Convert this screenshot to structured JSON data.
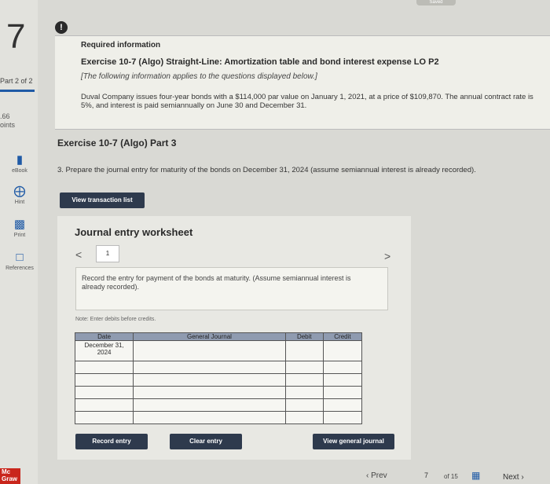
{
  "question_number": "7",
  "part_label": "Part 2 of 2",
  "points": [
    ".66",
    "oints"
  ],
  "tools": [
    {
      "label": "eBook",
      "icon": "book-icon"
    },
    {
      "label": "Hint",
      "icon": "hint-icon"
    },
    {
      "label": "Print",
      "icon": "print-icon"
    },
    {
      "label": "References",
      "icon": "references-icon"
    }
  ],
  "logo": [
    "Mc",
    "Graw"
  ],
  "saved": "Saved",
  "info": {
    "alert": "!",
    "required": "Required information",
    "exercise_title": "Exercise 10-7 (Algo) Straight-Line: Amortization table and bond interest expense LO P2",
    "note": "[The following information applies to the questions displayed below.]",
    "body": "Duval Company issues four-year bonds with a $114,000 par value on January 1, 2021, at a price of $109,870. The annual contract rate is 5%, and interest is paid semiannually on June 30 and December 31."
  },
  "part_title": "Exercise 10-7 (Algo) Part 3",
  "question": "3. Prepare the journal entry for maturity of the bonds on December 31, 2024 (assume semiannual interest is already recorded).",
  "view_transaction_list": "View transaction list",
  "worksheet": {
    "title": "Journal entry worksheet",
    "nav_prev": "<",
    "nav_next": ">",
    "tab": "1",
    "entry_text": "Record the entry for payment of the bonds at maturity. (Assume semiannual interest is already recorded).",
    "note": "Note: Enter debits before credits.",
    "headers": {
      "date": "Date",
      "journal": "General Journal",
      "debit": "Debit",
      "credit": "Credit"
    },
    "date_value": "December 31, 2024",
    "record_entry": "Record entry",
    "clear_entry": "Clear entry",
    "view_general_journal": "View general journal"
  },
  "footer": {
    "prev": "Prev",
    "page": "7",
    "of": "of 15",
    "next": "Next"
  }
}
